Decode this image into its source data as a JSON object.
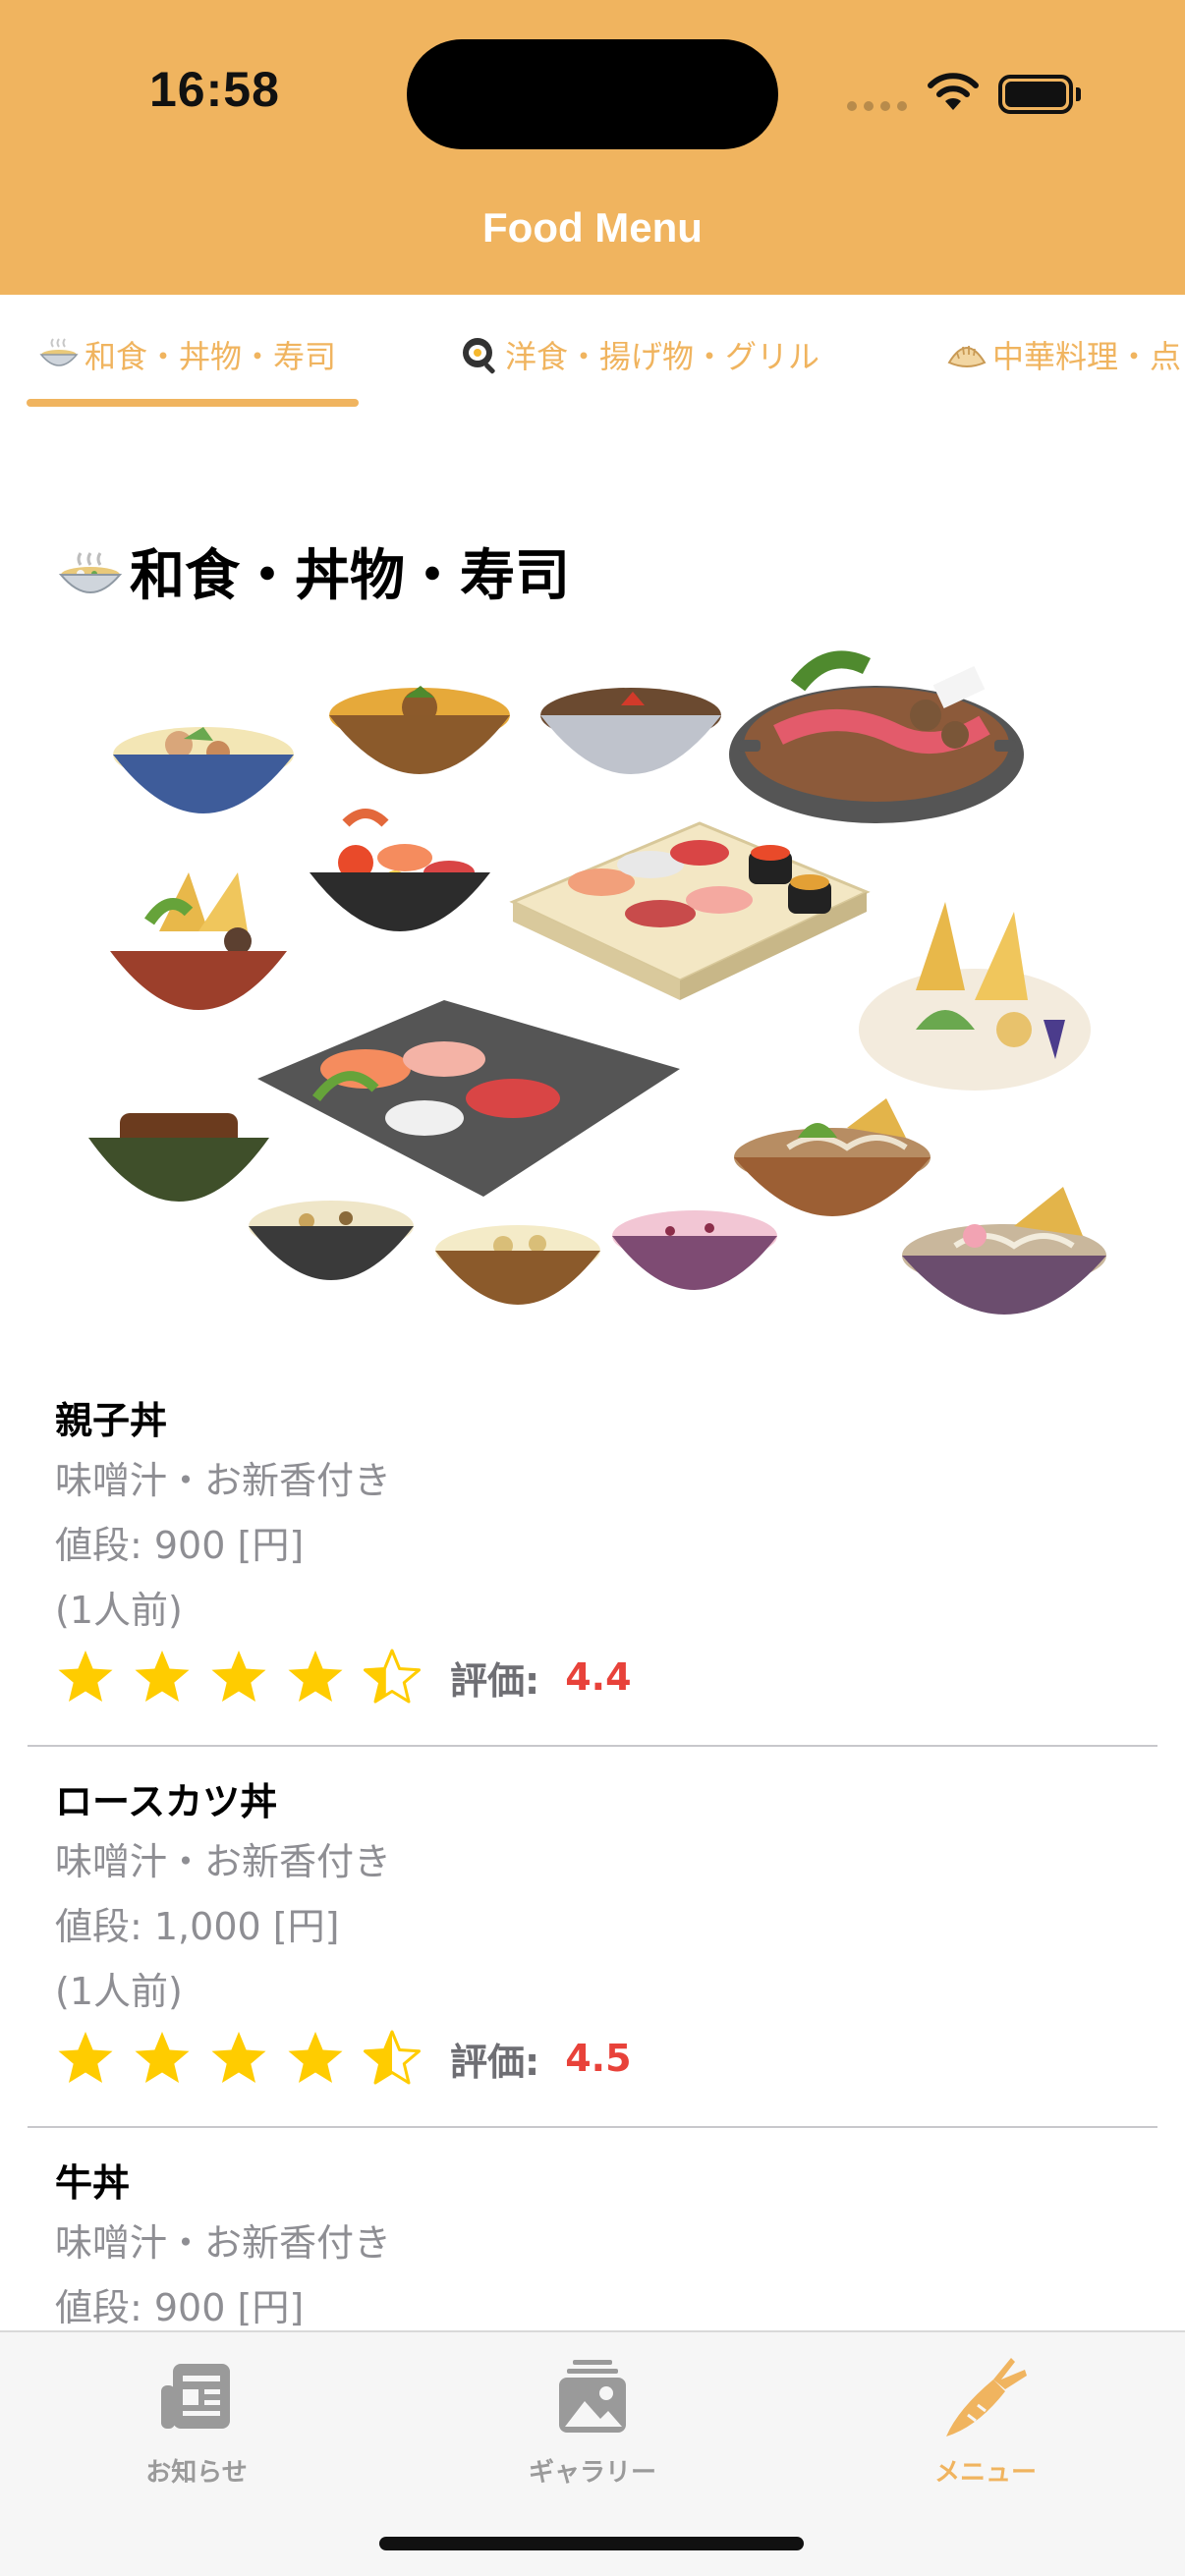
{
  "status_bar": {
    "time": "16:58"
  },
  "nav": {
    "title": "Food Menu"
  },
  "tabs": [
    {
      "label": "和食・丼物・寿司",
      "icon": "bowl-icon",
      "selected": true
    },
    {
      "label": "洋食・揚げ物・グリル",
      "icon": "frying-pan-icon",
      "selected": false
    },
    {
      "label": "中華料理・点",
      "icon": "dumpling-icon",
      "selected": false
    }
  ],
  "section": {
    "title": "和食・丼物・寿司",
    "icon": "bowl-icon"
  },
  "items": [
    {
      "name": "親子丼",
      "description": "味噌汁・お新香付き",
      "price": "値段: 900 [円]",
      "portion": "(1人前)",
      "rating_label": "評価:",
      "rating": "4.4",
      "rating_value": 4.4
    },
    {
      "name": "ロースカツ丼",
      "description": "味噌汁・お新香付き",
      "price": "値段: 1,000 [円]",
      "portion": "(1人前)",
      "rating_label": "評価:",
      "rating": "4.5",
      "rating_value": 4.5
    },
    {
      "name": "牛丼",
      "description": "味噌汁・お新香付き",
      "price": "値段: 900 [円]"
    }
  ],
  "tabbar": [
    {
      "label": "お知らせ",
      "icon": "newspaper-icon",
      "active": false
    },
    {
      "label": "ギャラリー",
      "icon": "photo-gallery-icon",
      "active": false
    },
    {
      "label": "メニュー",
      "icon": "carrot-icon",
      "active": true
    }
  ],
  "colors": {
    "accent": "#F0B45F",
    "rating_value": "#E8423A",
    "star": "#FFCC00",
    "secondary_text": "#8e8e93"
  }
}
